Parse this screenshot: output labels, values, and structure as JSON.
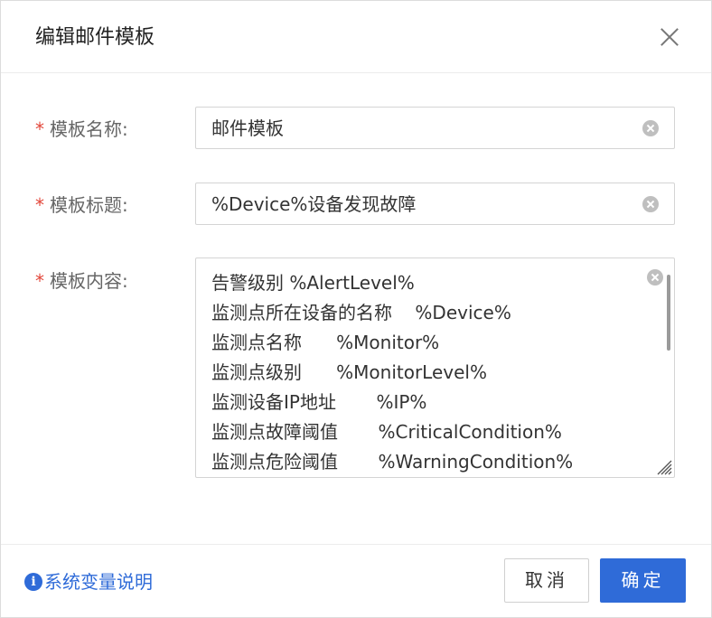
{
  "dialog": {
    "title": "编辑邮件模板"
  },
  "form": {
    "name": {
      "required_mark": "*",
      "label": "模板名称:",
      "value": "邮件模板"
    },
    "subject": {
      "required_mark": "*",
      "label": "模板标题:",
      "value": "%Device%设备发现故障"
    },
    "content": {
      "required_mark": "*",
      "label": "模板内容:",
      "lines": [
        "告警级别 %AlertLevel%",
        "监测点所在设备的名称    %Device%",
        "监测点名称      %Monitor%",
        "监测点级别      %MonitorLevel%",
        "监测设备IP地址       %IP%",
        "监测点故障阈值       %CriticalCondition%",
        "监测点危险阈值       %WarningCondition%"
      ]
    }
  },
  "footer": {
    "help_icon": "info-icon",
    "help_text": "系统变量说明",
    "cancel_label": "取消",
    "ok_label": "确定"
  },
  "colors": {
    "primary": "#2f6bd8",
    "required": "#e2463a"
  }
}
